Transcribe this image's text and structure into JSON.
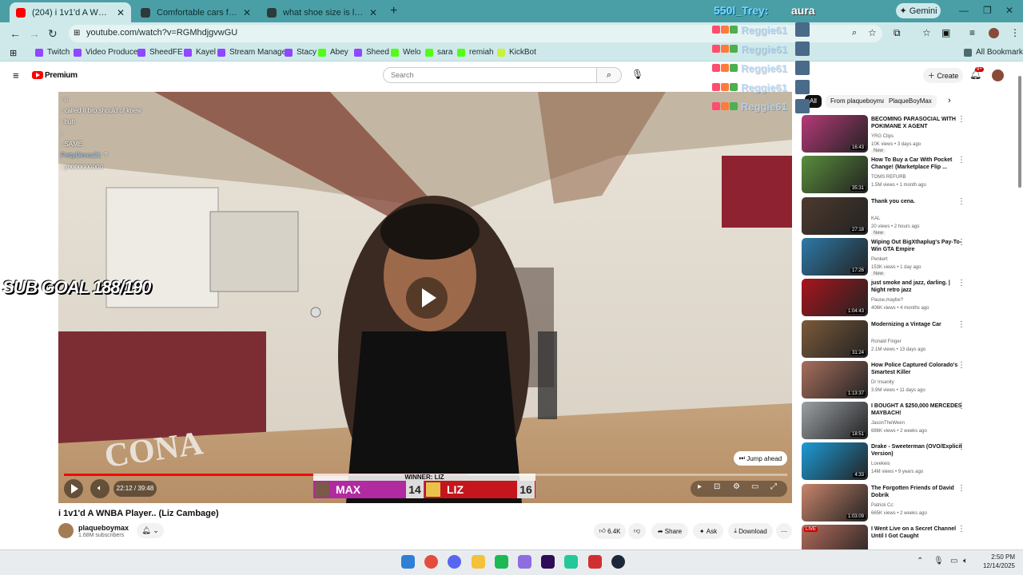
{
  "browser": {
    "tabs": [
      {
        "label": "(204) i 1v1'd A WNBA Player..",
        "active": true,
        "icon_color": "#ff0000"
      },
      {
        "label": "Comfortable cars for tall drivers",
        "active": false,
        "icon_color": "#2d3a3b"
      },
      {
        "label": "what shoe size is liz cambage -",
        "active": false,
        "icon_color": "#2d3a3b"
      }
    ],
    "new_tab": "+",
    "gemini_label": "Gemini",
    "url": "youtube.com/watch?v=RGMhdjgvwGU",
    "bookmarks": [
      {
        "label": "Twitch",
        "icon_color": "#9146ff"
      },
      {
        "label": "Video Producer",
        "icon_color": "#9146ff"
      },
      {
        "label": "SheedFE",
        "icon_color": "#9146ff"
      },
      {
        "label": "Kayel",
        "icon_color": "#9146ff"
      },
      {
        "label": "Stream Manager",
        "icon_color": "#9146ff"
      },
      {
        "label": "Stacy",
        "icon_color": "#9146ff"
      },
      {
        "label": "Abey",
        "icon_color": "#53fc18"
      },
      {
        "label": "Sheed",
        "icon_color": "#9146ff"
      },
      {
        "label": "Welo",
        "icon_color": "#53fc18"
      },
      {
        "label": "sara",
        "icon_color": "#53fc18"
      },
      {
        "label": "remiah",
        "icon_color": "#53fc18"
      },
      {
        "label": "KickBot",
        "icon_color": "#c8f03c"
      }
    ],
    "all_bookmarks": "All Bookmarks"
  },
  "youtube": {
    "logo_text": "Premium",
    "search_placeholder": "Search",
    "create_label": "Create",
    "notif_count": "9+"
  },
  "player": {
    "chat": [
      {
        "user": "",
        "msg": "o"
      },
      {
        "user": "",
        "msg": "called it bro should of knew"
      },
      {
        "user": "",
        "msg": "huh"
      },
      {
        "user": "",
        "msg": ""
      },
      {
        "user": "",
        "msg": "SAME"
      },
      {
        "user": "PettyDimez21",
        "msg": "?"
      },
      {
        "user": "",
        "msg": "yoooooooooo"
      }
    ],
    "sub_goal": "SUB GOAL 188/190",
    "jump_ahead": "Jump ahead",
    "time_display": "22:12 / 39:48",
    "progress": 0.558,
    "scoreboard": {
      "winner_label": "WINNER: LIZ",
      "left_name": "MAX",
      "left_score": "14",
      "right_name": "LIZ",
      "right_score": "16"
    }
  },
  "video": {
    "title": "i 1v1'd A WNBA Player.. (Liz Cambage)",
    "channel": "plaqueboymax",
    "subscribers": "1.68M subscribers",
    "likes": "6.4K",
    "share": "Share",
    "ask": "Ask",
    "download": "Download"
  },
  "sidebar": {
    "chips": [
      "All",
      "From plaqueboymax",
      "PlaqueBoyMax"
    ],
    "recommendations": [
      {
        "title": "BECOMING PARASOCIAL WITH POKIMANE X AGENT",
        "channel": "YRG Clips",
        "meta": "10K views • 3 days ago",
        "duration": "16:43",
        "new": "New",
        "color": "#b63a78"
      },
      {
        "title": "How To Buy a Car With Pocket Change! (Marketplace Flip ...",
        "channel": "TOMS REFURB",
        "meta": "1.5M views • 1 month ago",
        "duration": "35:31",
        "new": "",
        "color": "#5a8d3c"
      },
      {
        "title": "Thank you cena.",
        "channel": "KAL",
        "meta": "20 views • 2 hours ago",
        "duration": "27:18",
        "new": "New",
        "color": "#4d3a2d"
      },
      {
        "title": "Wiping Out BigXthaplug's Pay-To-Win GTA Empire",
        "channel": "Penkert",
        "meta": "153K views • 1 day ago",
        "duration": "17:26",
        "new": "New",
        "color": "#2e7aa8"
      },
      {
        "title": "just smoke and jazz, darling. | Night retro jazz",
        "channel": "Pause,maybe?",
        "meta": "406K views • 4 months ago",
        "duration": "1:04:43",
        "new": "",
        "color": "#a8151c"
      },
      {
        "title": "Modernizing a Vintage Car",
        "channel": "Ronald Finger",
        "meta": "2.1M views • 13 days ago",
        "duration": "31:24",
        "new": "",
        "color": "#7b5a3a"
      },
      {
        "title": "How Police Captured Colorado's Smartest Killer",
        "channel": "Dr Insanity",
        "meta": "3.9M views • 11 days ago",
        "duration": "1:13:37",
        "new": "",
        "color": "#a86f5e"
      },
      {
        "title": "I BOUGHT A $250,000 MERCEDES MAYBACH!",
        "channel": "JasonTheWeen",
        "meta": "686K views • 2 weeks ago",
        "duration": "18:51",
        "new": "",
        "color": "#9aa0a5"
      },
      {
        "title": "Drake - Sweeterman (OVO/Explicit Version)",
        "channel": "Lovekeis",
        "meta": "14M views • 9 years ago",
        "duration": "4:33",
        "new": "",
        "color": "#1c9bd6"
      },
      {
        "title": "The Forgotten Friends of David Dobrik",
        "channel": "Patrick Cc:",
        "meta": "665K views • 2 weeks ago",
        "duration": "1:03:09",
        "new": "",
        "color": "#c8856b"
      },
      {
        "title": "I Went Live on a Secret Channel Until I Got Caught",
        "channel": "",
        "meta": "",
        "duration": "LIVE",
        "new": "",
        "color": "#b36b5b"
      }
    ]
  },
  "overlay": {
    "name": "550l_Trey:",
    "word": "aura",
    "list_user": "Reggie61",
    "row_count": 5
  },
  "taskbar": {
    "time": "2:50 PM",
    "date": "12/14/2025",
    "apps": [
      {
        "name": "windows",
        "color": "#2f7fd6"
      },
      {
        "name": "chrome",
        "color": "#e24d3c"
      },
      {
        "name": "discord",
        "color": "#5865f2"
      },
      {
        "name": "explorer",
        "color": "#f3c13a"
      },
      {
        "name": "spotify",
        "color": "#1db954"
      },
      {
        "name": "copilot",
        "color": "#8f6ce0"
      },
      {
        "name": "premiere",
        "color": "#2e0c58"
      },
      {
        "name": "streamlabs",
        "color": "#24c799"
      },
      {
        "name": "app-red",
        "color": "#d12f2f"
      },
      {
        "name": "steam",
        "color": "#1b2838"
      }
    ]
  }
}
